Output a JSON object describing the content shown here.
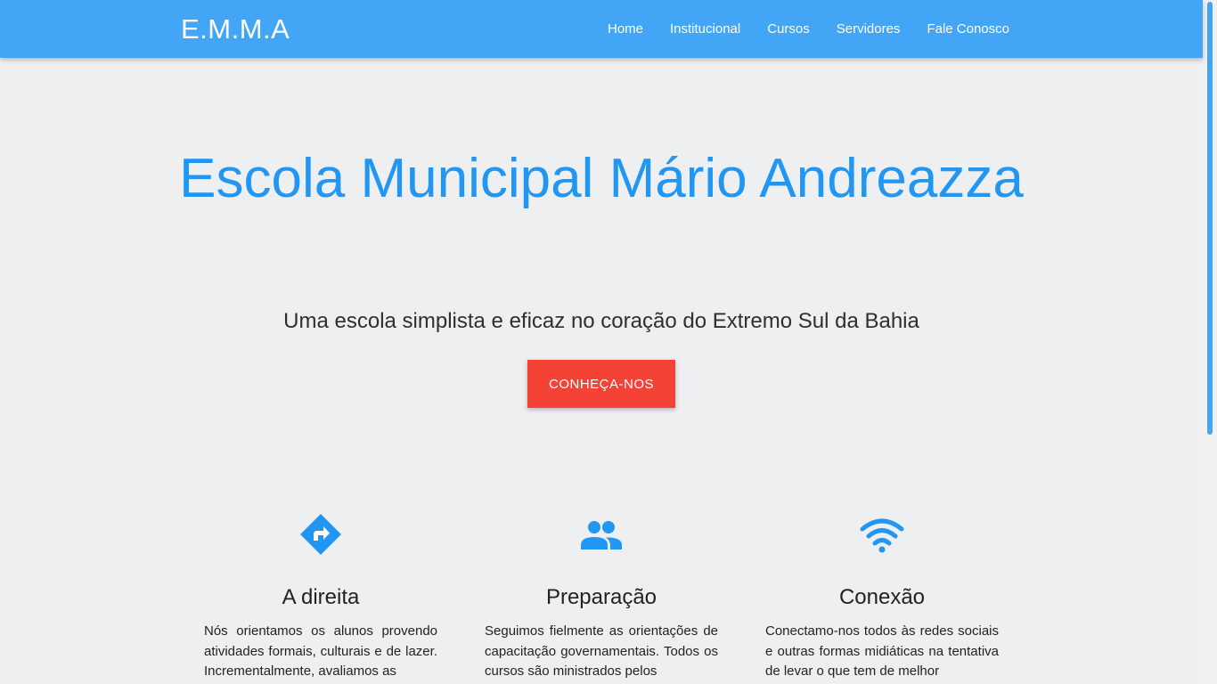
{
  "navbar": {
    "brand": "E.M.M.A",
    "items": [
      {
        "label": "Home"
      },
      {
        "label": "Institucional"
      },
      {
        "label": "Cursos"
      },
      {
        "label": "Servidores"
      },
      {
        "label": "Fale Conosco"
      }
    ]
  },
  "hero": {
    "title": "Escola Municipal Mário Andreazza",
    "subtitle": "Uma escola simplista e eficaz no coração do Extremo Sul da Bahia",
    "cta_label": "CONHEÇA-NOS"
  },
  "features": [
    {
      "icon": "directions-icon",
      "title": "A direita",
      "text": "Nós orientamos os alunos provendo atividades formais, culturais e de lazer. Incrementalmente, avaliamos as"
    },
    {
      "icon": "group-icon",
      "title": "Preparação",
      "text": "Seguimos fielmente as orientações de capacitação governamentais. Todos os cursos são ministrados pelos"
    },
    {
      "icon": "wifi-icon",
      "title": "Conexão",
      "text": "Conectamo-nos todos às redes sociais e outras formas midiáticas na tentativa de levar o que tem de melhor"
    }
  ],
  "colors": {
    "navbar": "#42a5f5",
    "title": "#2196f3",
    "cta": "#f44336",
    "background": "#eeeff1"
  }
}
